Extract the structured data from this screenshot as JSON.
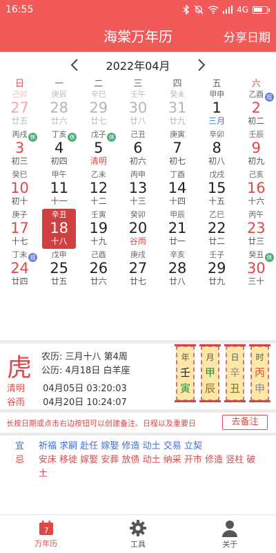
{
  "status_bar": {
    "time": "16:55",
    "network": "4G"
  },
  "header": {
    "title": "海棠万年历",
    "share_label": "分享日期"
  },
  "month_nav": {
    "label": "2022年04月"
  },
  "weekdays": [
    "日",
    "一",
    "二",
    "三",
    "四",
    "五",
    "六"
  ],
  "calendar": [
    [
      {
        "gz": "己卯",
        "day": "27",
        "lunar": "廿五",
        "faded": true,
        "weekend": true
      },
      {
        "gz": "庚辰",
        "day": "28",
        "lunar": "廿六",
        "faded": true
      },
      {
        "gz": "辛巳",
        "day": "29",
        "lunar": "廿七",
        "faded": true
      },
      {
        "gz": "壬午",
        "day": "30",
        "lunar": "廿八",
        "faded": true
      },
      {
        "gz": "癸未",
        "day": "31",
        "lunar": "廿九",
        "faded": true
      },
      {
        "gz": "甲申",
        "day": "1",
        "lunar": "三月",
        "lunar_style": "blue"
      },
      {
        "gz": "乙酉",
        "day": "2",
        "lunar": "初二",
        "weekend": true,
        "badge": "班"
      }
    ],
    [
      {
        "gz": "丙戌",
        "day": "3",
        "lunar": "初三",
        "weekend": true,
        "badge": "休"
      },
      {
        "gz": "丁亥",
        "day": "4",
        "lunar": "初四",
        "badge": "休"
      },
      {
        "gz": "戊子",
        "day": "5",
        "lunar": "清明",
        "lunar_style": "term",
        "badge": "休"
      },
      {
        "gz": "己丑",
        "day": "6",
        "lunar": "初六"
      },
      {
        "gz": "庚寅",
        "day": "7",
        "lunar": "初七"
      },
      {
        "gz": "辛卯",
        "day": "8",
        "lunar": "初八"
      },
      {
        "gz": "壬辰",
        "day": "9",
        "lunar": "初九",
        "weekend": true
      }
    ],
    [
      {
        "gz": "癸巳",
        "day": "10",
        "lunar": "初十",
        "weekend": true
      },
      {
        "gz": "甲午",
        "day": "11",
        "lunar": "十一"
      },
      {
        "gz": "乙未",
        "day": "12",
        "lunar": "十二"
      },
      {
        "gz": "丙申",
        "day": "13",
        "lunar": "十三"
      },
      {
        "gz": "丁酉",
        "day": "14",
        "lunar": "十四"
      },
      {
        "gz": "戊戌",
        "day": "15",
        "lunar": "十五"
      },
      {
        "gz": "己亥",
        "day": "16",
        "lunar": "十六",
        "weekend": true
      }
    ],
    [
      {
        "gz": "庚子",
        "day": "17",
        "lunar": "十七",
        "weekend": true
      },
      {
        "gz": "辛丑",
        "day": "18",
        "lunar": "十八",
        "selected": true
      },
      {
        "gz": "壬寅",
        "day": "19",
        "lunar": "十九"
      },
      {
        "gz": "癸卯",
        "day": "20",
        "lunar": "谷雨",
        "lunar_style": "term"
      },
      {
        "gz": "甲辰",
        "day": "21",
        "lunar": "廿一"
      },
      {
        "gz": "乙巳",
        "day": "22",
        "lunar": "廿二"
      },
      {
        "gz": "丙午",
        "day": "23",
        "lunar": "廿三",
        "weekend": true
      }
    ],
    [
      {
        "gz": "丁未",
        "day": "24",
        "lunar": "廿四",
        "weekend": true,
        "badge": "班"
      },
      {
        "gz": "戊申",
        "day": "25",
        "lunar": "廿五"
      },
      {
        "gz": "己酉",
        "day": "26",
        "lunar": "廿六"
      },
      {
        "gz": "庚戌",
        "day": "27",
        "lunar": "廿七"
      },
      {
        "gz": "辛亥",
        "day": "28",
        "lunar": "廿八"
      },
      {
        "gz": "壬子",
        "day": "29",
        "lunar": "廿九"
      },
      {
        "gz": "癸丑",
        "day": "30",
        "lunar": "三十",
        "weekend": true,
        "badge": "休"
      }
    ]
  ],
  "badge_colors": {
    "休": "#4caf7a",
    "班": "#6a7fdc"
  },
  "detail": {
    "zodiac": "虎",
    "lunar_text": "农历: 三月十八 第4周",
    "solar_text": "公历: 4月18日 白羊座",
    "terms": [
      {
        "name": "清明",
        "time": "04月05日 03:20:03"
      },
      {
        "name": "谷雨",
        "time": "04月20日 10:24:07"
      }
    ],
    "pillars": [
      {
        "label": "年",
        "stem": "壬",
        "branch": "寅",
        "stem_color": "#222222",
        "branch_color": "#2e8b3a"
      },
      {
        "label": "月",
        "stem": "甲",
        "branch": "辰",
        "stem_color": "#2e8b3a",
        "branch_color": "#8a6a1a"
      },
      {
        "label": "日",
        "stem": "辛",
        "branch": "丑",
        "stem_color": "#8a8a8a",
        "branch_color": "#8a6a1a"
      },
      {
        "label": "时",
        "stem": "丙",
        "branch": "申",
        "stem_color": "#e04848",
        "branch_color": "#8a8a8a"
      }
    ]
  },
  "hint": {
    "text": "长按日期或点击右边按钮可以创建备注、日程以及重要日",
    "button": "去备注"
  },
  "yiji": {
    "yi_label": "宜",
    "yi_items": "祈福 求嗣 赴任 嫁娶 修造 动土 交易 立契",
    "ji_label": "忌",
    "ji_items": "安床 移徙 嫁娶 安葬 放债 动土 纳采 开市 修造 竖柱 破土"
  },
  "bottom_nav": [
    {
      "label": "万年历",
      "icon": "calendar-icon",
      "active": true,
      "icon_text": "7"
    },
    {
      "label": "工具",
      "icon": "gear-icon",
      "active": false
    },
    {
      "label": "关于",
      "icon": "person-icon",
      "active": false
    }
  ],
  "colors": {
    "brand": "#f25a5a",
    "accent_red": "#e04848",
    "selected": "#cf4141",
    "blue": "#3f6fd8"
  }
}
